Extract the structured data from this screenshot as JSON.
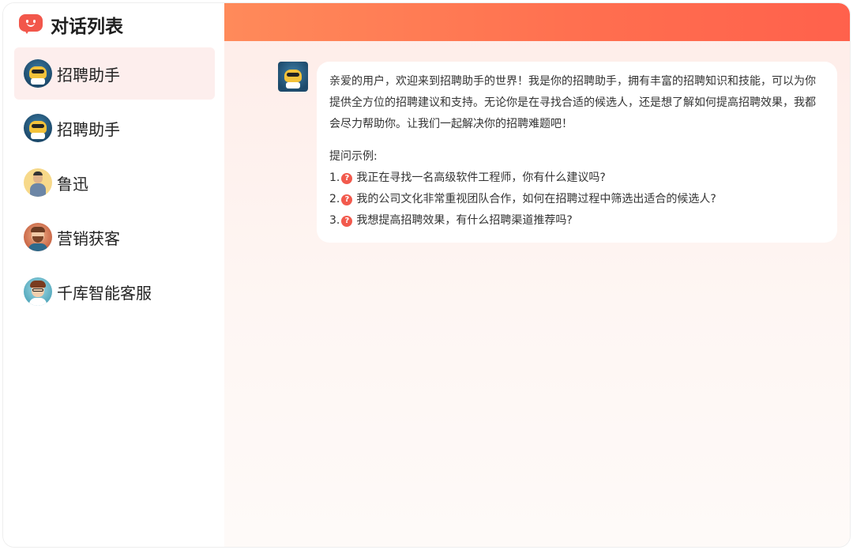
{
  "sidebar": {
    "title": "对话列表",
    "items": [
      {
        "label": "招聘助手",
        "avatar": "robot-avatar",
        "active": true
      },
      {
        "label": "招聘助手",
        "avatar": "robot-avatar",
        "active": false
      },
      {
        "label": "鲁迅",
        "avatar": "luxun-avatar",
        "active": false
      },
      {
        "label": "营销获客",
        "avatar": "marketing-avatar",
        "active": false
      },
      {
        "label": "千库智能客服",
        "avatar": "service-avatar",
        "active": false
      }
    ]
  },
  "chat": {
    "message": {
      "sender_avatar": "robot-avatar",
      "greeting": "亲爱的用户，欢迎来到招聘助手的世界！我是你的招聘助手，拥有丰富的招聘知识和技能，可以为你提供全方位的招聘建议和支持。无论你是在寻找合适的候选人，还是想了解如何提高招聘效果，我都会尽力帮助你。让我们一起解决你的招聘难题吧！",
      "examples_heading": "提问示例:",
      "examples": [
        {
          "num": "1.",
          "text": "我正在寻找一名高级软件工程师，你有什么建议吗?"
        },
        {
          "num": "2.",
          "text": "我的公司文化非常重视团队合作，如何在招聘过程中筛选出适合的候选人?"
        },
        {
          "num": "3.",
          "text": "我想提高招聘效果，有什么招聘渠道推荐吗?"
        }
      ]
    }
  },
  "icons": {
    "logo": "chat-bubble-icon",
    "question": "question-icon",
    "question_glyph": "?"
  },
  "colors": {
    "accent": "#f2574b",
    "header_gradient_start": "#ff8a5a",
    "header_gradient_end": "#ff614c",
    "active_item_bg": "#fdeeed"
  }
}
